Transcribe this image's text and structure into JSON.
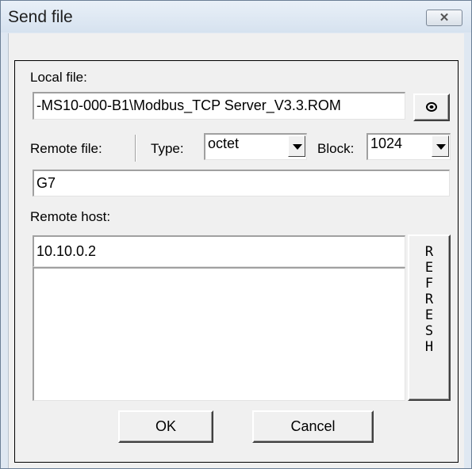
{
  "window": {
    "title": "Send file",
    "close_icon": "close-icon"
  },
  "local_file": {
    "label": "Local file:",
    "value": "-MS10-000-B1\\Modbus_TCP Server_V3.3.ROM",
    "browse_icon": "browse-icon"
  },
  "remote_file": {
    "label": "Remote file:",
    "value": "G7"
  },
  "type": {
    "label": "Type:",
    "selected": "octet"
  },
  "block": {
    "label": "Block:",
    "selected": "1024"
  },
  "remote_host": {
    "label": "Remote host:",
    "value": "10.10.0.2",
    "list_items": []
  },
  "refresh": {
    "label": "REFRESH"
  },
  "buttons": {
    "ok": "OK",
    "cancel": "Cancel"
  },
  "colors": {
    "dialog_face": "#f0f0f0",
    "title_bar": "#dfe8f2",
    "frame": "#6b7f96"
  }
}
